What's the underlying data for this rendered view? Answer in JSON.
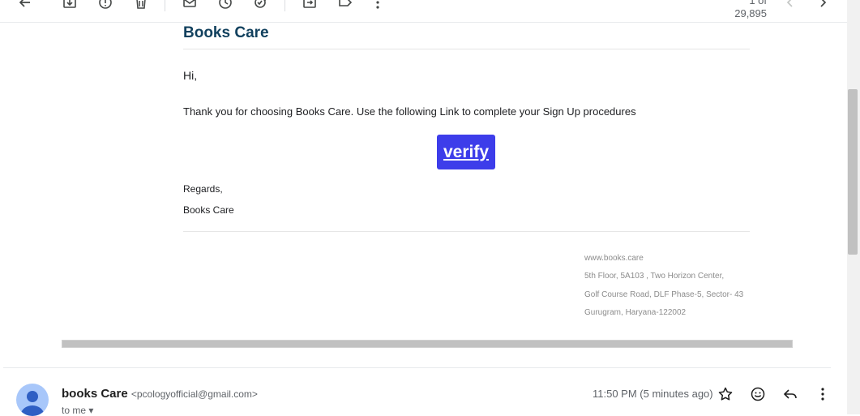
{
  "toolbar": {
    "count": "1 of 29,895",
    "icons": [
      "back-arrow-icon",
      "archive-icon",
      "report-spam-icon",
      "delete-icon",
      "mark-unread-icon",
      "snooze-icon",
      "add-task-icon",
      "move-to-icon",
      "label-icon",
      "more-vert-icon",
      "prev-icon",
      "next-icon"
    ]
  },
  "email": {
    "brand": "Books Care",
    "greeting": "Hi,",
    "body": "Thank you for choosing Books Care. Use the following Link to complete your Sign Up procedures",
    "button": "verify",
    "regards": "Regards,",
    "signoff": "Books Care",
    "footer": {
      "website": "www.books.care",
      "address1": "5th Floor, 5A103 , Two Horizon Center,",
      "address2": "Golf Course Road, DLF Phase-5, Sector- 43",
      "address3": "Gurugram, Haryana-122002"
    }
  },
  "message": {
    "sender_name": "books Care",
    "sender_email": "<pcologyofficial@gmail.com>",
    "to": "to me",
    "time": "11:50 PM (5 minutes ago)"
  },
  "colors": {
    "brand": "#12415e",
    "button": "#3d3dea",
    "avatar_bg": "#a8c7fa",
    "avatar_fg": "#2f5fc4"
  }
}
